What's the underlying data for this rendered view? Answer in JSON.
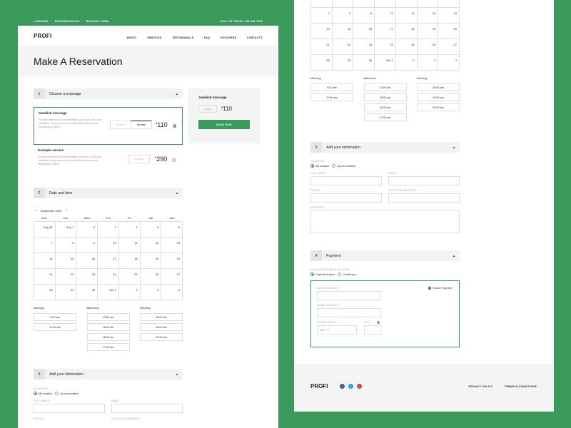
{
  "topbar": {
    "links": [
      "LANDINGS",
      "DOCUMENTATION",
      "BOOKING FORM"
    ],
    "call": "CALL US TODAY: 123 456 7890"
  },
  "nav": {
    "logo": "PROFI",
    "links": [
      "ABOUT",
      "SERVICES",
      "TESTIMONIALS",
      "FAQ",
      "VOUCHERS",
      "CONTACTS"
    ]
  },
  "hero": {
    "title": "Make A Reservation"
  },
  "step1": {
    "number": "1",
    "title": "Choose a massage",
    "services": [
      {
        "title": "Swedish massage",
        "description": "Focused attention on the essentials: your back, neck and shoulders, where you need it most! Addresses tension headaches & office.",
        "durations": [
          "30 MIN",
          "90 MIN"
        ],
        "currency": "$",
        "price": "110"
      },
      {
        "title": "Example service",
        "description": "Focused attention on the essentials: your back, neck and shoulders, where you need it most! Addresses tension headaches & office.",
        "durations": [
          "60 MIN"
        ],
        "currency": "$",
        "price": "290"
      }
    ]
  },
  "summary": {
    "title": "Swedish massage",
    "duration": "30 MIN",
    "currency": "$",
    "price": "110",
    "button": "BOOK NOW"
  },
  "step2": {
    "number": "2",
    "title": "Date and time",
    "month": "September 2020",
    "weekdays": [
      "Mon",
      "Tue",
      "Wed",
      "Thu",
      "Fri",
      "Sat",
      "Sun"
    ],
    "days": [
      "Aug 31",
      "Sep 1",
      "2",
      "3",
      "4",
      "5",
      "6",
      "7",
      "8",
      "9",
      "10",
      "11",
      "12",
      "13",
      "14",
      "15",
      "16",
      "17",
      "18",
      "19",
      "20",
      "21",
      "22",
      "23",
      "24",
      "25",
      "26",
      "27",
      "28",
      "29",
      "30",
      "Oct 1",
      "2",
      "3",
      "4"
    ],
    "morning_label": "Morning",
    "afternoon_label": "Afternoon",
    "evening_label": "Evening",
    "morning": [
      "9:00 am",
      "11:30 am"
    ],
    "afternoon": [
      "13:00 am",
      "15:00 am",
      "16:00 am",
      "17:00 am"
    ],
    "evening": [
      "18:00 am",
      "19:00 am",
      "20:00 am"
    ]
  },
  "step3": {
    "number": "3",
    "title": "Add your information",
    "location_label": "LOCATION",
    "option_my": "My location",
    "option_your": "At your location",
    "full_name": "FULL NAME",
    "email": "EMAIL",
    "phone": "PHONE",
    "location_address": "LOCATION ADDRESS",
    "message": "MESSAGE"
  },
  "step4": {
    "number": "4",
    "title": "Payment",
    "method_label": "CHOOSE PAYMENT METHOD",
    "option_cash": "Cash at location",
    "option_card": "Credit card",
    "secure": "Secure Payment",
    "card_number": "CARD NUMBER",
    "name_on_card": "NAME ON CARD",
    "expiry": "EXPIRY DATE",
    "expiry_placeholder": "MM / YY",
    "cvc": "CVC",
    "help_icon": "?"
  },
  "footer": {
    "logo": "PROFI",
    "social": [
      "f",
      "t",
      "p"
    ],
    "up_icon": "↑",
    "links": [
      "PRIVACY POLICY",
      "TERMS & CONDITIONS"
    ]
  },
  "colors": {
    "accent": "#3a9a5a",
    "facebook": "#3b5998",
    "twitter": "#1da1f2",
    "pinterest": "#d33a3a"
  }
}
